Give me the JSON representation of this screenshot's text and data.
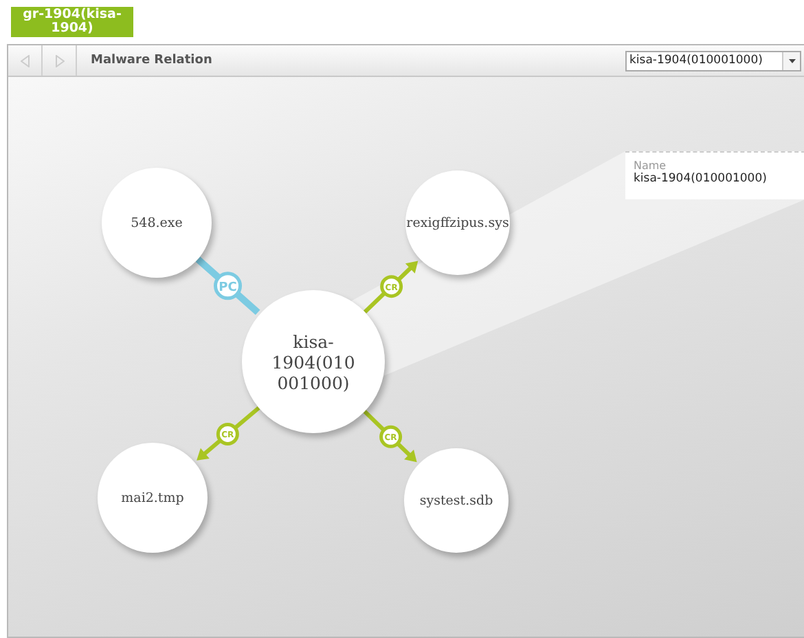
{
  "group_tag": {
    "label": "gr-1904(kisa-1904)"
  },
  "toolbar": {
    "title": "Malware Relation",
    "back_disabled": true,
    "forward_disabled": true,
    "dropdown": {
      "value": "kisa-1904(010001000)"
    }
  },
  "nodes": [
    {
      "label": "548.exe",
      "selected": false
    },
    {
      "label": "rexigffzipus.sys",
      "selected": false
    },
    {
      "label": "kisa-1904(010001000)",
      "selected": true
    },
    {
      "label": "mai2.tmp",
      "selected": false
    },
    {
      "label": "systest.sdb",
      "selected": false
    }
  ],
  "edges": [
    {
      "kind": "pc",
      "label": "PC"
    },
    {
      "kind": "cr",
      "label": "CR"
    },
    {
      "kind": "cr",
      "label": "CR"
    },
    {
      "kind": "cr",
      "label": "CR"
    }
  ],
  "info_panel": {
    "label": "Name",
    "value": "kisa-1904(010001000)"
  }
}
